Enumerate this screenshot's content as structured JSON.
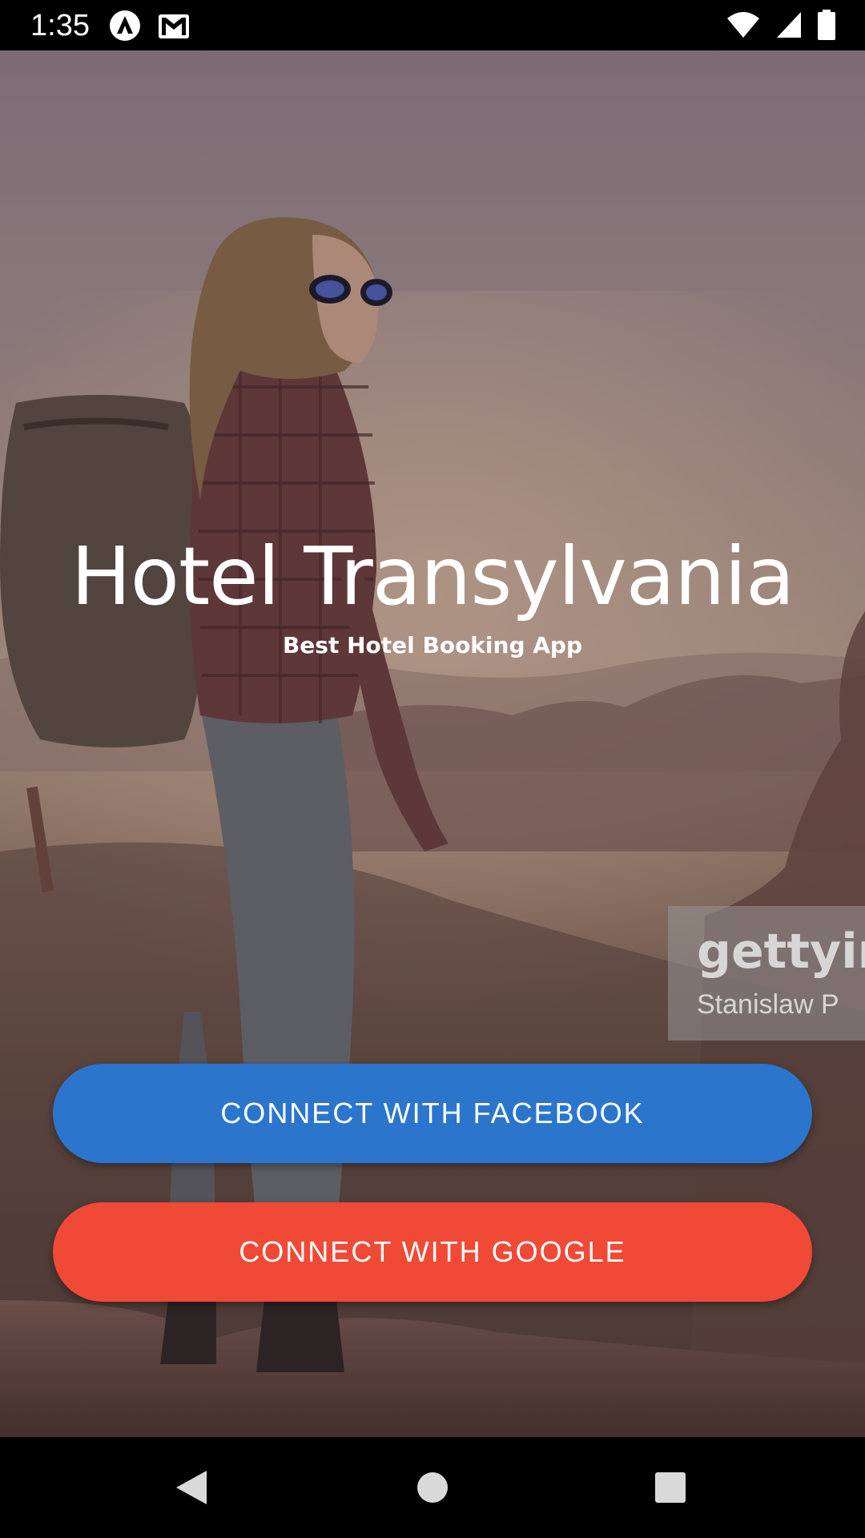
{
  "status_bar": {
    "time": "1:35",
    "left_icons": [
      "app-notification-icon",
      "gmail-icon"
    ],
    "right_icons": [
      "wifi-icon",
      "cell-signal-icon",
      "battery-icon"
    ]
  },
  "main": {
    "title": "Hotel Transylvania",
    "subtitle": "Best Hotel Booking App",
    "watermark": {
      "brand": "gettyim",
      "credit": "Stanislaw P"
    },
    "facebook_button": "CONNECT WITH FACEBOOK",
    "google_button": "CONNECT WITH GOOGLE"
  },
  "nav_bar": {
    "buttons": [
      "back-icon",
      "home-icon",
      "recents-icon"
    ]
  },
  "colors": {
    "facebook": "#2b75cd",
    "google": "#f04a37",
    "status_bar": "#000000",
    "text": "#ffffff"
  }
}
